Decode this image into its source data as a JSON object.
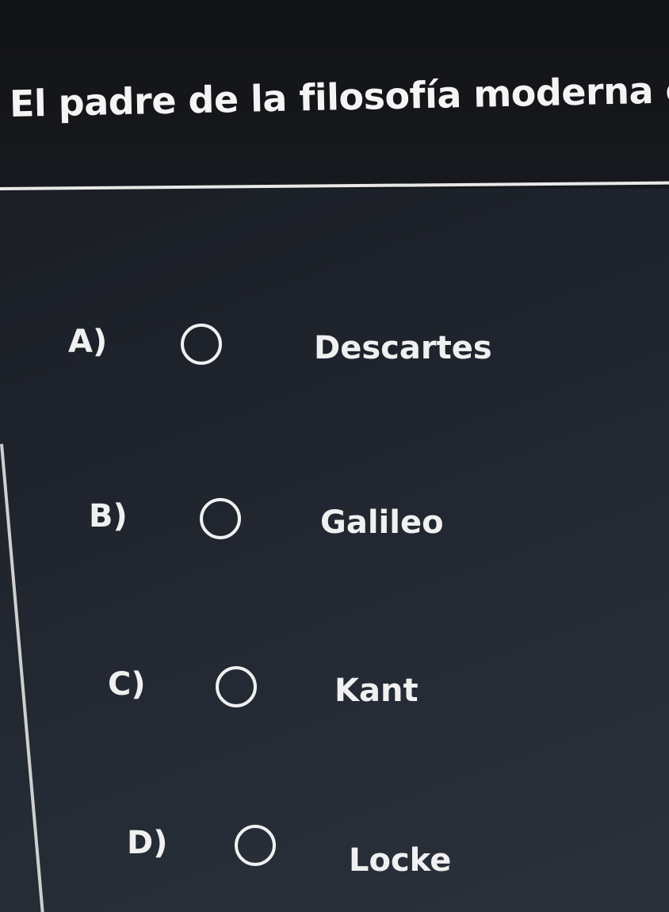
{
  "question": {
    "text": "El padre de la filosofía moderna es:"
  },
  "options": [
    {
      "letter": "A)",
      "label": "Descartes",
      "selected": false
    },
    {
      "letter": "B)",
      "label": "Galileo",
      "selected": false
    },
    {
      "letter": "C)",
      "label": "Kant",
      "selected": false
    },
    {
      "letter": "D)",
      "label": "Locke",
      "selected": false
    }
  ]
}
